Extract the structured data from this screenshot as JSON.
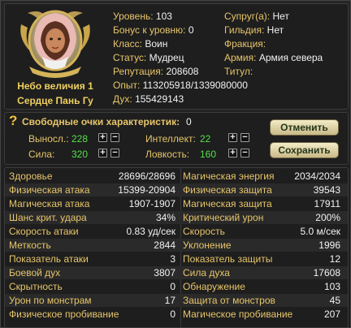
{
  "character": {
    "name_line1": "Небо величия 1",
    "name_line2": "Сердце Пань Гу"
  },
  "info": {
    "level": {
      "label": "Уровень:",
      "value": "103"
    },
    "level_bonus": {
      "label": "Бонус к уровню:",
      "value": "0"
    },
    "class": {
      "label": "Класс:",
      "value": "Воин"
    },
    "status": {
      "label": "Статус:",
      "value": "Мудрец"
    },
    "reputation": {
      "label": "Репутация:",
      "value": "208608"
    },
    "experience": {
      "label": "Опыт:",
      "value": "113205918/1339080000"
    },
    "spirit": {
      "label": "Дух:",
      "value": "155429143"
    },
    "spouse": {
      "label": "Супруг(а):",
      "value": "Нет"
    },
    "guild": {
      "label": "Гильдия:",
      "value": "Нет"
    },
    "faction": {
      "label": "Фракция:",
      "value": ""
    },
    "army": {
      "label": "Армия:",
      "value": "Армия севера"
    },
    "title": {
      "label": "Титул:",
      "value": ""
    }
  },
  "stat_points": {
    "free_label": "Свободные очки характеристик:",
    "free_value": "0",
    "vit": {
      "label": "Выносл.:",
      "value": "228"
    },
    "str": {
      "label": "Сила:",
      "value": "320"
    },
    "int": {
      "label": "Интеллект:",
      "value": "22"
    },
    "dex": {
      "label": "Ловкость:",
      "value": "160"
    },
    "plus": "+",
    "minus": "−",
    "cancel_button": "Отменить",
    "save_button": "Сохранить"
  },
  "stats": [
    {
      "l": "Здоровье",
      "v": "28696/28696",
      "l2": "Магическая энергия",
      "v2": "2034/2034"
    },
    {
      "l": "Физическая атака",
      "v": "15399-20904",
      "l2": "Физическая защита",
      "v2": "39543"
    },
    {
      "l": "Магическая атака",
      "v": "1907-1907",
      "l2": "Магическая защита",
      "v2": "17911"
    },
    {
      "l": "Шанс крит. удара",
      "v": "34%",
      "l2": "Критический урон",
      "v2": "200%"
    },
    {
      "l": "Скорость атаки",
      "v": "0.83 уд/сек",
      "l2": "Скорость",
      "v2": "5.0 м/сек"
    },
    {
      "l": "Меткость",
      "v": "2844",
      "l2": "Уклонение",
      "v2": "1996"
    },
    {
      "l": "Показатель атаки",
      "v": "3",
      "l2": "Показатель защиты",
      "v2": "12"
    },
    {
      "l": "Боевой дух",
      "v": "3807",
      "l2": "Сила духа",
      "v2": "17608"
    },
    {
      "l": "Скрытность",
      "v": "0",
      "l2": "Обнаружение",
      "v2": "103"
    },
    {
      "l": "Урон по монстрам",
      "v": "17",
      "l2": "Защита от монстров",
      "v2": "45"
    },
    {
      "l": "Физическое пробивание",
      "v": "0",
      "l2": "Магическое пробивание",
      "v2": "207"
    }
  ]
}
